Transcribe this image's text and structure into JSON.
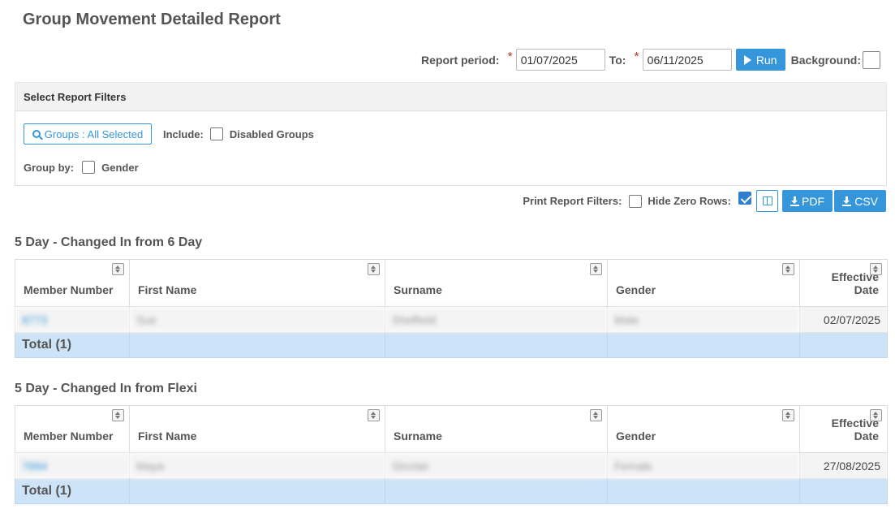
{
  "page_title": "Group Movement Detailed Report",
  "period": {
    "label": "Report period:",
    "from_value": "01/07/2025",
    "to_label": "To:",
    "to_value": "06/11/2025",
    "required_mark": "*",
    "run_label": "Run",
    "background_label": "Background:"
  },
  "filters": {
    "header": "Select Report Filters",
    "groups_button": "Groups : All Selected",
    "include_label": "Include:",
    "disabled_groups_label": "Disabled Groups",
    "group_by_label": "Group by:",
    "gender_label": "Gender"
  },
  "toolbar": {
    "print_filters_label": "Print Report Filters:",
    "hide_zero_label": "Hide Zero Rows:",
    "pdf_label": "PDF",
    "csv_label": "CSV"
  },
  "columns": [
    "Member Number",
    "First Name",
    "Surname",
    "Gender",
    "Effective Date"
  ],
  "sections": [
    {
      "title": "5 Day - Changed In from 6 Day",
      "rows": [
        {
          "member_number": "8773",
          "first_name": "Sue",
          "surname": "Sheffield",
          "gender": "Male",
          "effective_date": "02/07/2025"
        }
      ],
      "total_label": "Total (1)"
    },
    {
      "title": "5 Day - Changed In from Flexi",
      "rows": [
        {
          "member_number": "7884",
          "first_name": "Maya",
          "surname": "Sinclair",
          "gender": "Female",
          "effective_date": "27/08/2025"
        }
      ],
      "total_label": "Total (1)"
    }
  ],
  "colors": {
    "accent": "#3596dc",
    "total_row": "#cde3f7",
    "required": "#c0392b"
  }
}
